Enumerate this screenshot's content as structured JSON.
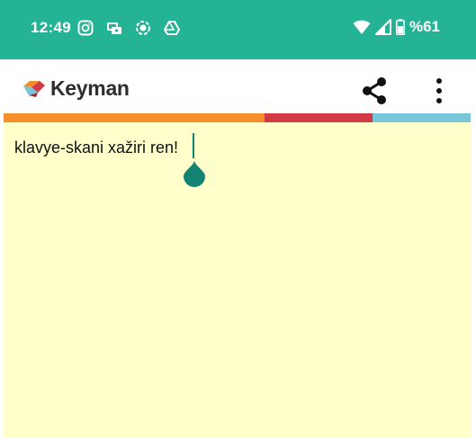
{
  "status_bar": {
    "time": "12:49",
    "left_icons": [
      "instagram-icon",
      "vpn-key-icon",
      "record-icon",
      "drive-icon"
    ],
    "right_icons": [
      "wifi-icon",
      "signal-icon",
      "battery-icon"
    ],
    "battery_percent": "%61"
  },
  "app_bar": {
    "title": "Keyman",
    "logo": "keyman-logo",
    "actions": [
      "share-icon",
      "more-vert-icon"
    ]
  },
  "language_stripe": {
    "colors": [
      "#f58f2c",
      "#d23b46",
      "#79c6da"
    ]
  },
  "editor": {
    "text": "klavye-skani xažiri ren!",
    "background": "#ffffcc",
    "cursor_color": "#138374"
  },
  "colors": {
    "status_bar": "#25b396",
    "app_bar": "#ffffff"
  }
}
